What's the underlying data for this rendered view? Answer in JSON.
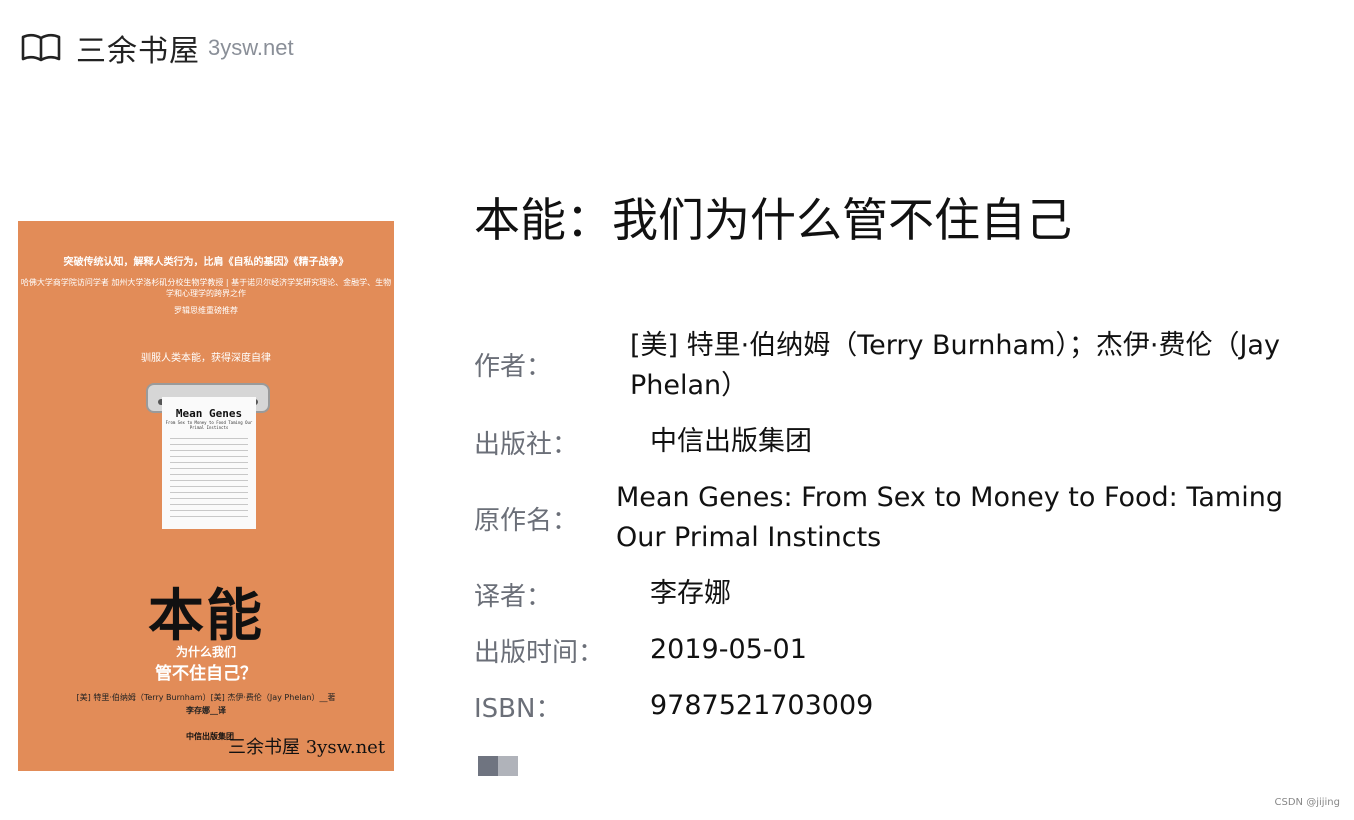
{
  "site": {
    "name": "三余书屋",
    "domain": "3ysw.net",
    "icon": "book-open-icon"
  },
  "book": {
    "title": "本能：我们为什么管不住自己",
    "fields": [
      {
        "label": "作者：",
        "value": "[美] 特里·伯纳姆（Terry Burnham）；杰伊·费伦（Jay Phelan）"
      },
      {
        "label": "出版社：",
        "value": "中信出版集团"
      },
      {
        "label": "原作名：",
        "value": "Mean Genes: From Sex to Money to Food: Taming Our Primal Instincts"
      },
      {
        "label": "译者：",
        "value": "李存娜"
      },
      {
        "label": "出版时间：",
        "value": "2019-05-01"
      },
      {
        "label": "ISBN：",
        "value": "9787521703009"
      }
    ]
  },
  "cover": {
    "tagline": "突破传统认知，解释人类行为，比肩《自私的基因》《精子战争》",
    "credentials_left": "哈佛大学商学院访问学者 加州大学洛杉矶分校生物学教授",
    "credentials_right": "基于诺贝尔经济学奖研究理论、金融学、生物学和心理学的跨界之作",
    "recommend": "罗辑思维重磅推荐",
    "slogan": "驯服人类本能，获得深度自律",
    "paper_title": "Mean Genes",
    "paper_subtitle": "From Sex to Money to Food Taming Our Primal Instincts",
    "big_title": "本能",
    "subtitle_1": "为什么我们",
    "subtitle_2": "管不住自己？",
    "authors": "[美] 特里·伯纳姆（Terry Burnham）[美] 杰伊·费伦（Jay Phelan）__著",
    "translator": "李存娜__译",
    "publisher": "中信出版集团",
    "watermark": "三余书屋 3ysw.net",
    "background": "#e28c58"
  },
  "pager": {
    "colors": [
      "#6f7480",
      "#b0b3ba"
    ]
  },
  "credit": "CSDN @jijing"
}
